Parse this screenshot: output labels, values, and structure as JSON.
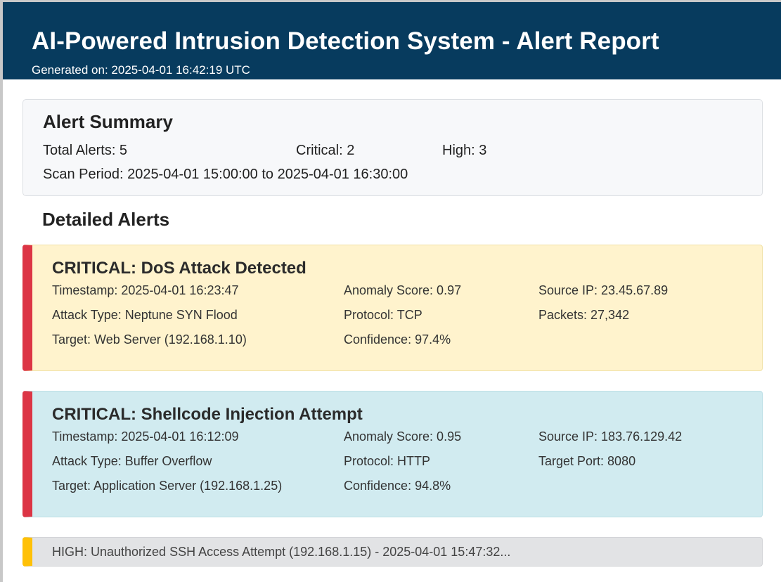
{
  "header": {
    "title": "AI-Powered Intrusion Detection System - Alert Report",
    "generated": "Generated on: 2025-04-01 16:42:19 UTC"
  },
  "summary": {
    "title": "Alert Summary",
    "total": "Total Alerts: 5",
    "critical": "Critical: 2",
    "high": "High: 3",
    "scan_period": "Scan Period: 2025-04-01 15:00:00 to 2025-04-01 16:30:00"
  },
  "detailed_title": "Detailed Alerts",
  "alerts": [
    {
      "title": "CRITICAL: DoS Attack Detected",
      "timestamp": "Timestamp: 2025-04-01 16:23:47",
      "anomaly": "Anomaly Score: 0.97",
      "source_ip": "Source IP: 23.45.67.89",
      "attack_type": "Attack Type: Neptune SYN Flood",
      "protocol": "Protocol: TCP",
      "extra": "Packets: 27,342",
      "target": "Target: Web Server (192.168.1.10)",
      "confidence": "Confidence: 97.4%",
      "accent": "#dc3545",
      "background": "#fff3cd"
    },
    {
      "title": "CRITICAL: Shellcode Injection Attempt",
      "timestamp": "Timestamp: 2025-04-01 16:12:09",
      "anomaly": "Anomaly Score: 0.95",
      "source_ip": "Source IP: 183.76.129.42",
      "attack_type": "Attack Type: Buffer Overflow",
      "protocol": "Protocol: HTTP",
      "extra": "Target Port: 8080",
      "target": "Target: Application Server (192.168.1.25)",
      "confidence": "Confidence: 94.8%",
      "accent": "#dc3545",
      "background": "#d1ebf0"
    }
  ],
  "collapsed": {
    "text": "HIGH: Unauthorized SSH Access Attempt (192.168.1.15) - 2025-04-01 15:47:32...",
    "accent": "#ffc107"
  },
  "colors": {
    "header_bg": "#073b5e",
    "critical": "#dc3545",
    "high": "#ffc107"
  }
}
